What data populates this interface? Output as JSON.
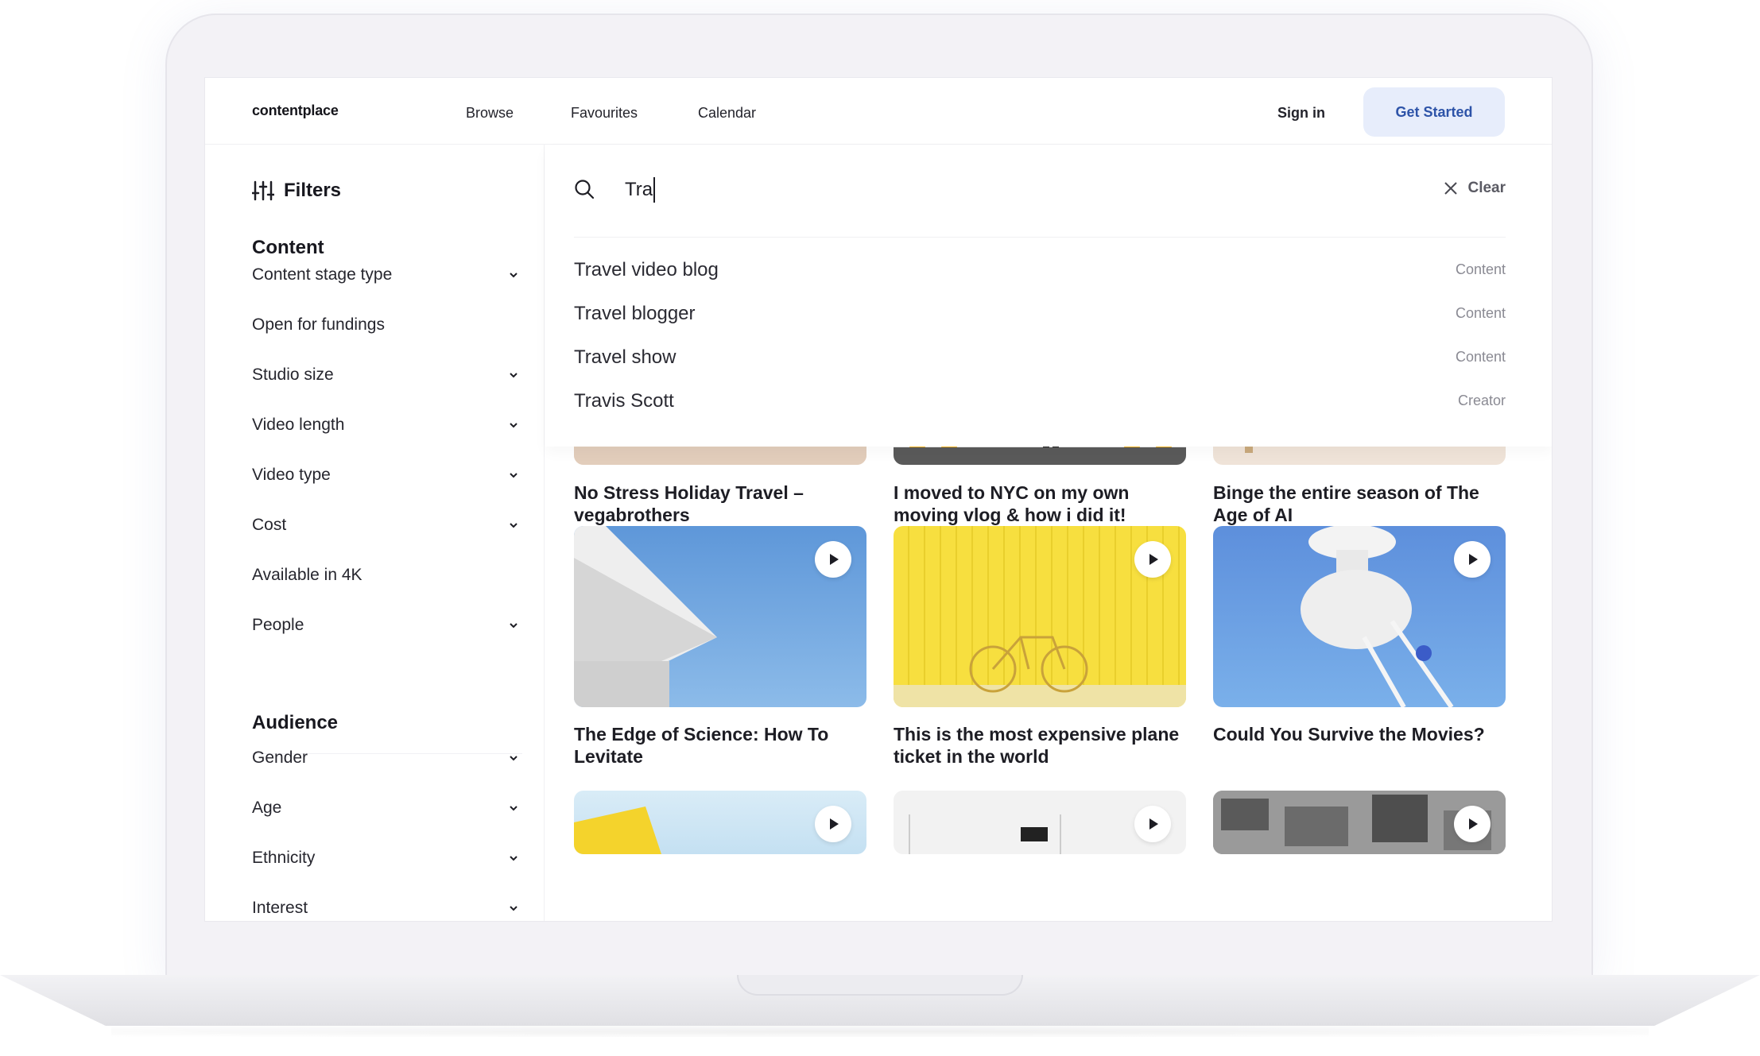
{
  "header": {
    "logo": "contentplace",
    "nav": [
      "Browse",
      "Favourites",
      "Calendar"
    ],
    "sign_in": "Sign in",
    "get_started": "Get Started"
  },
  "sidebar": {
    "filters_label": "Filters",
    "content_title": "Content",
    "content_items": [
      {
        "label": "Content stage type",
        "dropdown": true
      },
      {
        "label": "Open for fundings",
        "dropdown": false
      },
      {
        "label": "Studio size",
        "dropdown": true
      },
      {
        "label": "Video length",
        "dropdown": true
      },
      {
        "label": "Video type",
        "dropdown": true
      },
      {
        "label": "Cost",
        "dropdown": true
      },
      {
        "label": "Available in 4K",
        "dropdown": false
      },
      {
        "label": "People",
        "dropdown": true
      }
    ],
    "audience_title": "Audience",
    "audience_items": [
      {
        "label": "Gender"
      },
      {
        "label": "Age"
      },
      {
        "label": "Ethnicity"
      },
      {
        "label": "Interest"
      }
    ]
  },
  "search": {
    "value": "Tra",
    "clear_label": "Clear",
    "suggestions": [
      {
        "text": "Travel video blog",
        "type": "Content"
      },
      {
        "text": "Travel blogger",
        "type": "Content"
      },
      {
        "text": "Travel show",
        "type": "Content"
      },
      {
        "text": "Travis Scott",
        "type": "Creator"
      }
    ]
  },
  "cards": [
    {
      "title": "No Stress Holiday Travel – vegabrothers"
    },
    {
      "title": "I moved to NYC on my own moving vlog & how i did it!"
    },
    {
      "title": "Binge the entire season of The Age of AI"
    },
    {
      "title": "The Edge of Science: How To Levitate"
    },
    {
      "title": "This is the most expensive plane ticket in the world"
    },
    {
      "title": "Could You Survive the Movies?"
    }
  ],
  "colors": {
    "accent_bg": "#e7edfb",
    "accent_text": "#2d53a8",
    "sky_blue": "#6a9fdb",
    "yellow_wall": "#f7e04a"
  }
}
